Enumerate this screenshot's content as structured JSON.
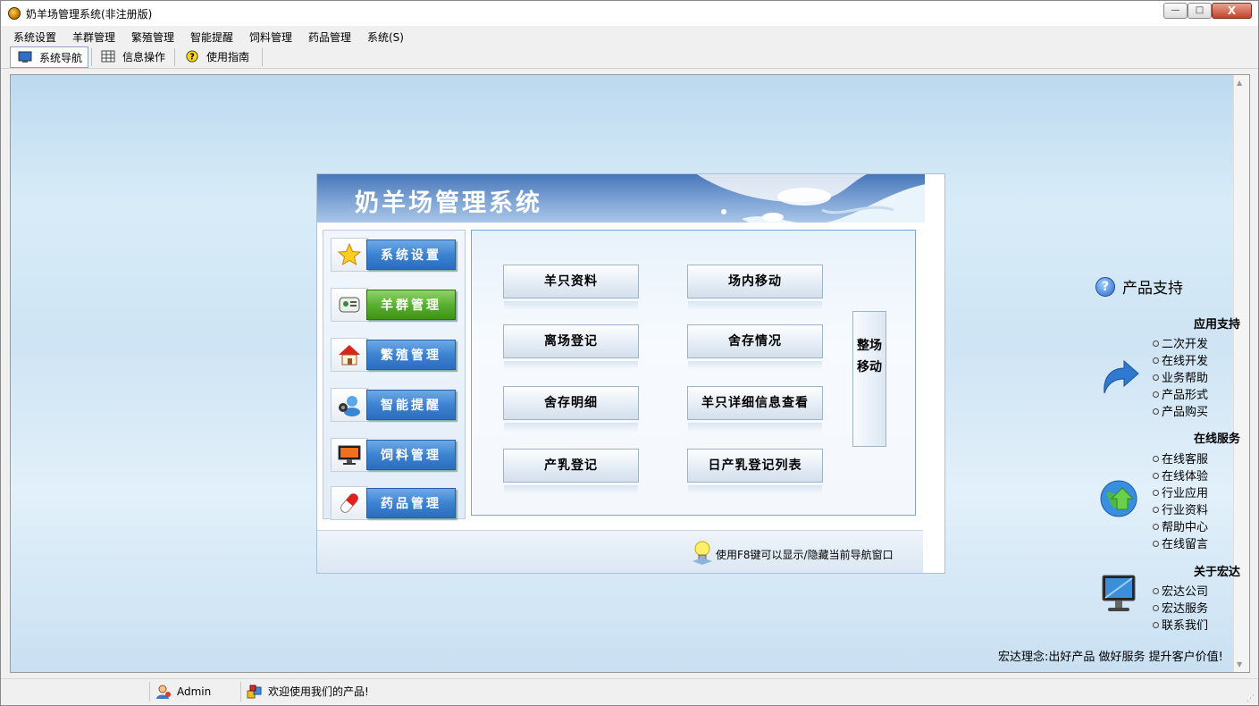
{
  "window": {
    "title": "奶羊场管理系统(非注册版)",
    "btn_min": "—",
    "btn_max": "□",
    "btn_close": "X"
  },
  "menu": [
    "系统设置",
    "羊群管理",
    "繁殖管理",
    "智能提醒",
    "饲料管理",
    "药品管理",
    "系统(S)"
  ],
  "toolbar": {
    "nav": "系统导航",
    "info": "信息操作",
    "guide": "使用指南"
  },
  "panel": {
    "title": "奶羊场管理系统",
    "nav": [
      "系统设置",
      "羊群管理",
      "繁殖管理",
      "智能提醒",
      "饲料管理",
      "药品管理"
    ],
    "active_nav": "羊群管理",
    "buttons": [
      "羊只资料",
      "场内移动",
      "离场登记",
      "舍存情况",
      "舍存明细",
      "羊只详细信息查看",
      "产乳登记",
      "日产乳登记列表"
    ],
    "vertical_button": "整场移动",
    "hint": "使用F8键可以显示/隐藏当前导航窗口"
  },
  "support": {
    "title": "产品支持",
    "sections": [
      {
        "title": "应用支持",
        "links": [
          "二次开发",
          "在线开发",
          "业务帮助",
          "产品形式",
          "产品购买"
        ],
        "icon": "blue-arrow-icon"
      },
      {
        "title": "在线服务",
        "links": [
          "在线客服",
          "在线体验",
          "行业应用",
          "行业资料",
          "帮助中心",
          "在线留言"
        ],
        "icon": "globe-icon"
      },
      {
        "title": "关于宏达",
        "links": [
          "宏达公司",
          "宏达服务",
          "联系我们"
        ],
        "icon": "monitor-icon"
      }
    ],
    "motto": "宏达理念:出好产品 做好服务 提升客户价值!"
  },
  "status": {
    "user": "Admin",
    "message": "欢迎使用我们的产品!"
  },
  "colors": {
    "accent_blue": "#3c83d2",
    "active_green": "#5bb032",
    "background": "#cfe4f4"
  }
}
